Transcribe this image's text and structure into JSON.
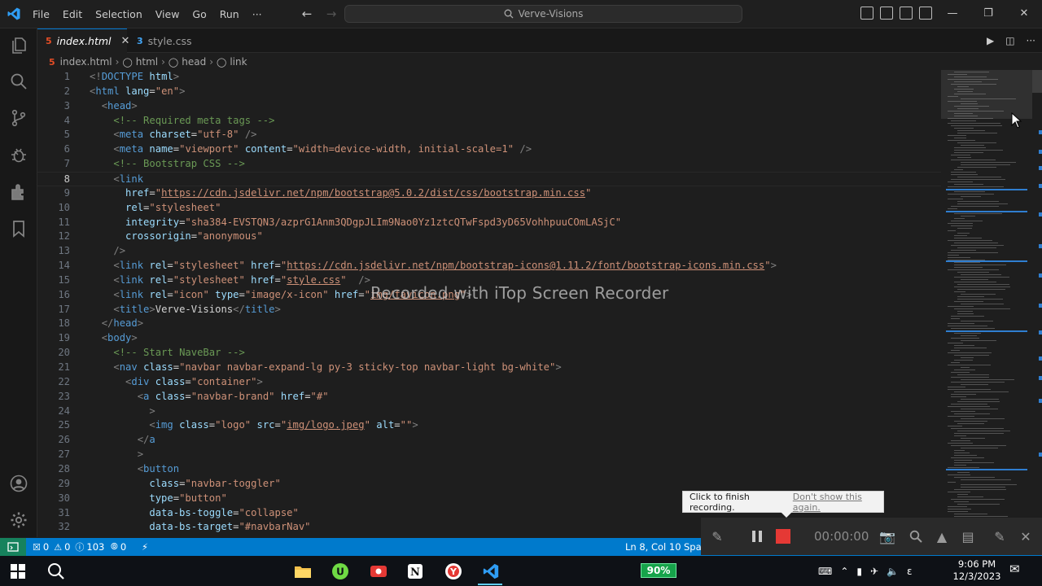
{
  "titlebar": {
    "menu": [
      "File",
      "Edit",
      "Selection",
      "View",
      "Go",
      "Run",
      "···"
    ],
    "search": "Verve-Visions"
  },
  "tabs": [
    {
      "label": "index.html",
      "icon": "html5-file-icon",
      "active": true
    },
    {
      "label": "style.css",
      "icon": "css-file-icon",
      "active": false
    }
  ],
  "breadcrumb": [
    "index.html",
    "html",
    "head",
    "link"
  ],
  "editor": {
    "current_line": 8,
    "lines": [
      {
        "n": "1",
        "tokens": [
          [
            "t",
            "<!"
          ],
          [
            "tn",
            "DOCTYPE"
          ],
          [
            "tx",
            " "
          ],
          [
            "an",
            "html"
          ],
          [
            "t",
            ">"
          ]
        ]
      },
      {
        "n": "2",
        "tokens": [
          [
            "t",
            "<"
          ],
          [
            "tn",
            "html"
          ],
          [
            "tx",
            " "
          ],
          [
            "an",
            "lang"
          ],
          [
            "tx",
            "="
          ],
          [
            "av",
            "\"en\""
          ],
          [
            "t",
            ">"
          ]
        ]
      },
      {
        "n": "3",
        "tokens": [
          [
            "tx",
            "  "
          ],
          [
            "t",
            "<"
          ],
          [
            "tn",
            "head"
          ],
          [
            "t",
            ">"
          ]
        ]
      },
      {
        "n": "4",
        "tokens": [
          [
            "tx",
            "    "
          ],
          [
            "cm",
            "<!-- Required meta tags -->"
          ]
        ]
      },
      {
        "n": "5",
        "tokens": [
          [
            "tx",
            "    "
          ],
          [
            "t",
            "<"
          ],
          [
            "tn",
            "meta"
          ],
          [
            "tx",
            " "
          ],
          [
            "an",
            "charset"
          ],
          [
            "tx",
            "="
          ],
          [
            "av",
            "\"utf-8\""
          ],
          [
            "tx",
            " "
          ],
          [
            "t",
            "/>"
          ]
        ]
      },
      {
        "n": "6",
        "tokens": [
          [
            "tx",
            "    "
          ],
          [
            "t",
            "<"
          ],
          [
            "tn",
            "meta"
          ],
          [
            "tx",
            " "
          ],
          [
            "an",
            "name"
          ],
          [
            "tx",
            "="
          ],
          [
            "av",
            "\"viewport\""
          ],
          [
            "tx",
            " "
          ],
          [
            "an",
            "content"
          ],
          [
            "tx",
            "="
          ],
          [
            "av",
            "\"width=device-width, initial-scale=1\""
          ],
          [
            "tx",
            " "
          ],
          [
            "t",
            "/>"
          ]
        ]
      },
      {
        "n": "7",
        "tokens": [
          [
            "tx",
            "    "
          ],
          [
            "cm",
            "<!-- Bootstrap CSS -->"
          ]
        ]
      },
      {
        "n": "8",
        "tokens": [
          [
            "tx",
            "    "
          ],
          [
            "t",
            "<"
          ],
          [
            "tn",
            "link"
          ]
        ]
      },
      {
        "n": "9",
        "tokens": [
          [
            "tx",
            "      "
          ],
          [
            "an",
            "href"
          ],
          [
            "tx",
            "="
          ],
          [
            "av",
            "\""
          ],
          [
            "avu",
            "https://cdn.jsdelivr.net/npm/bootstrap@5.0.2/dist/css/bootstrap.min.css"
          ],
          [
            "av",
            "\""
          ]
        ]
      },
      {
        "n": "10",
        "tokens": [
          [
            "tx",
            "      "
          ],
          [
            "an",
            "rel"
          ],
          [
            "tx",
            "="
          ],
          [
            "av",
            "\"stylesheet\""
          ]
        ]
      },
      {
        "n": "11",
        "tokens": [
          [
            "tx",
            "      "
          ],
          [
            "an",
            "integrity"
          ],
          [
            "tx",
            "="
          ],
          [
            "av",
            "\"sha384-EVSTQN3/azprG1Anm3QDgpJLIm9Nao0Yz1ztcQTwFspd3yD65VohhpuuCOmLASjC\""
          ]
        ]
      },
      {
        "n": "12",
        "tokens": [
          [
            "tx",
            "      "
          ],
          [
            "an",
            "crossorigin"
          ],
          [
            "tx",
            "="
          ],
          [
            "av",
            "\"anonymous\""
          ]
        ]
      },
      {
        "n": "13",
        "tokens": [
          [
            "tx",
            "    "
          ],
          [
            "t",
            "/>"
          ]
        ]
      },
      {
        "n": "14",
        "tokens": [
          [
            "tx",
            "    "
          ],
          [
            "t",
            "<"
          ],
          [
            "tn",
            "link"
          ],
          [
            "tx",
            " "
          ],
          [
            "an",
            "rel"
          ],
          [
            "tx",
            "="
          ],
          [
            "av",
            "\"stylesheet\""
          ],
          [
            "tx",
            " "
          ],
          [
            "an",
            "href"
          ],
          [
            "tx",
            "="
          ],
          [
            "av",
            "\""
          ],
          [
            "avu",
            "https://cdn.jsdelivr.net/npm/bootstrap-icons@1.11.2/font/bootstrap-icons.min.css"
          ],
          [
            "av",
            "\""
          ],
          [
            "t",
            ">"
          ]
        ]
      },
      {
        "n": "15",
        "tokens": [
          [
            "tx",
            "    "
          ],
          [
            "t",
            "<"
          ],
          [
            "tn",
            "link"
          ],
          [
            "tx",
            " "
          ],
          [
            "an",
            "rel"
          ],
          [
            "tx",
            "="
          ],
          [
            "av",
            "\"stylesheet\""
          ],
          [
            "tx",
            " "
          ],
          [
            "an",
            "href"
          ],
          [
            "tx",
            "="
          ],
          [
            "av",
            "\""
          ],
          [
            "avu",
            "style.css"
          ],
          [
            "av",
            "\""
          ],
          [
            "tx",
            "  "
          ],
          [
            "t",
            "/>"
          ]
        ]
      },
      {
        "n": "16",
        "tokens": [
          [
            "tx",
            "    "
          ],
          [
            "t",
            "<"
          ],
          [
            "tn",
            "link"
          ],
          [
            "tx",
            " "
          ],
          [
            "an",
            "rel"
          ],
          [
            "tx",
            "="
          ],
          [
            "av",
            "\"icon\""
          ],
          [
            "tx",
            " "
          ],
          [
            "an",
            "type"
          ],
          [
            "tx",
            "="
          ],
          [
            "av",
            "\"image/x-icon\""
          ],
          [
            "tx",
            " "
          ],
          [
            "an",
            "href"
          ],
          [
            "tx",
            "="
          ],
          [
            "av",
            "\""
          ],
          [
            "avu",
            "img/favicon.png"
          ],
          [
            "av",
            "\""
          ],
          [
            "t",
            ">"
          ]
        ]
      },
      {
        "n": "17",
        "tokens": [
          [
            "tx",
            "    "
          ],
          [
            "t",
            "<"
          ],
          [
            "tn",
            "title"
          ],
          [
            "t",
            ">"
          ],
          [
            "tx",
            "Verve-Visions"
          ],
          [
            "t",
            "</"
          ],
          [
            "tn",
            "title"
          ],
          [
            "t",
            ">"
          ]
        ]
      },
      {
        "n": "18",
        "tokens": [
          [
            "tx",
            "  "
          ],
          [
            "t",
            "</"
          ],
          [
            "tn",
            "head"
          ],
          [
            "t",
            ">"
          ]
        ]
      },
      {
        "n": "19",
        "tokens": [
          [
            "tx",
            "  "
          ],
          [
            "t",
            "<"
          ],
          [
            "tn",
            "body"
          ],
          [
            "t",
            ">"
          ]
        ]
      },
      {
        "n": "20",
        "tokens": [
          [
            "tx",
            "    "
          ],
          [
            "cm",
            "<!-- Start NaveBar -->"
          ]
        ]
      },
      {
        "n": "21",
        "tokens": [
          [
            "tx",
            "    "
          ],
          [
            "t",
            "<"
          ],
          [
            "tn",
            "nav"
          ],
          [
            "tx",
            " "
          ],
          [
            "an",
            "class"
          ],
          [
            "tx",
            "="
          ],
          [
            "av",
            "\"navbar navbar-expand-lg py-3 sticky-top navbar-light bg-white\""
          ],
          [
            "t",
            ">"
          ]
        ]
      },
      {
        "n": "22",
        "tokens": [
          [
            "tx",
            "      "
          ],
          [
            "t",
            "<"
          ],
          [
            "tn",
            "div"
          ],
          [
            "tx",
            " "
          ],
          [
            "an",
            "class"
          ],
          [
            "tx",
            "="
          ],
          [
            "av",
            "\"container\""
          ],
          [
            "t",
            ">"
          ]
        ]
      },
      {
        "n": "23",
        "tokens": [
          [
            "tx",
            "        "
          ],
          [
            "t",
            "<"
          ],
          [
            "tn",
            "a"
          ],
          [
            "tx",
            " "
          ],
          [
            "an",
            "class"
          ],
          [
            "tx",
            "="
          ],
          [
            "av",
            "\"navbar-brand\""
          ],
          [
            "tx",
            " "
          ],
          [
            "an",
            "href"
          ],
          [
            "tx",
            "="
          ],
          [
            "av",
            "\"#\""
          ]
        ]
      },
      {
        "n": "24",
        "tokens": [
          [
            "tx",
            "          "
          ],
          [
            "t",
            ">"
          ]
        ]
      },
      {
        "n": "25",
        "tokens": [
          [
            "tx",
            "          "
          ],
          [
            "t",
            "<"
          ],
          [
            "tn",
            "img"
          ],
          [
            "tx",
            " "
          ],
          [
            "an",
            "class"
          ],
          [
            "tx",
            "="
          ],
          [
            "av",
            "\"logo\""
          ],
          [
            "tx",
            " "
          ],
          [
            "an",
            "src"
          ],
          [
            "tx",
            "="
          ],
          [
            "av",
            "\""
          ],
          [
            "avu",
            "img/logo.jpeg"
          ],
          [
            "av",
            "\""
          ],
          [
            "tx",
            " "
          ],
          [
            "an",
            "alt"
          ],
          [
            "tx",
            "="
          ],
          [
            "av",
            "\"\""
          ],
          [
            "t",
            ">"
          ]
        ]
      },
      {
        "n": "26",
        "tokens": [
          [
            "tx",
            "        "
          ],
          [
            "t",
            "</"
          ],
          [
            "tn",
            "a"
          ]
        ]
      },
      {
        "n": "27",
        "tokens": [
          [
            "tx",
            "        "
          ],
          [
            "t",
            ">"
          ]
        ]
      },
      {
        "n": "28",
        "tokens": [
          [
            "tx",
            "        "
          ],
          [
            "t",
            "<"
          ],
          [
            "tn",
            "button"
          ]
        ]
      },
      {
        "n": "29",
        "tokens": [
          [
            "tx",
            "          "
          ],
          [
            "an",
            "class"
          ],
          [
            "tx",
            "="
          ],
          [
            "av",
            "\"navbar-toggler\""
          ]
        ]
      },
      {
        "n": "30",
        "tokens": [
          [
            "tx",
            "          "
          ],
          [
            "an",
            "type"
          ],
          [
            "tx",
            "="
          ],
          [
            "av",
            "\"button\""
          ]
        ]
      },
      {
        "n": "31",
        "tokens": [
          [
            "tx",
            "          "
          ],
          [
            "an",
            "data-bs-toggle"
          ],
          [
            "tx",
            "="
          ],
          [
            "av",
            "\"collapse\""
          ]
        ]
      },
      {
        "n": "32",
        "tokens": [
          [
            "tx",
            "          "
          ],
          [
            "an",
            "data-bs-target"
          ],
          [
            "tx",
            "="
          ],
          [
            "av",
            "\"#navbarNav\""
          ]
        ]
      }
    ]
  },
  "watermark": "Recorded with iTop Screen Recorder",
  "statusbar": {
    "errors": "0",
    "warnings": "0",
    "info": "103",
    "ports": "0",
    "position": "Ln 8, Col 10",
    "spaces": "Spa"
  },
  "recorder": {
    "tooltip_text": "Click to finish recording.",
    "tooltip_link": "Don't show this again.",
    "time": "00:00:00"
  },
  "taskbar": {
    "battery": "90%",
    "lang": "ε",
    "time": "9:06 PM",
    "date": "12/3/2023"
  },
  "colors": {
    "statusbar": "#007acc",
    "remote": "#16825d",
    "accent": "#0078d4",
    "record": "#e53935"
  }
}
